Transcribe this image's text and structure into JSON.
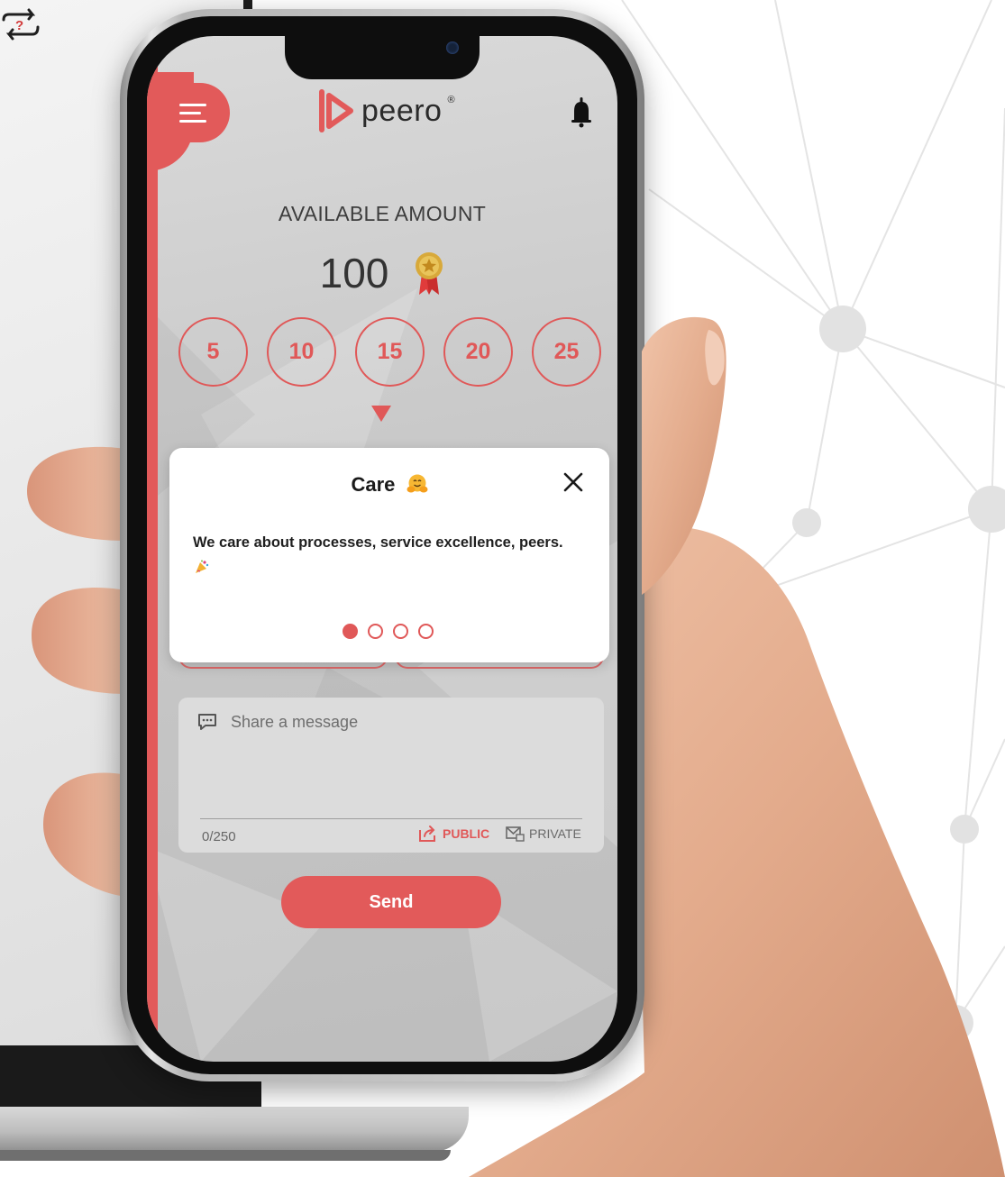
{
  "app": {
    "brand": "peero",
    "brand_mark": "®"
  },
  "header": {
    "menu_icon": "hamburger-menu-icon",
    "notification_icon": "bell-icon"
  },
  "balance": {
    "label": "AVAILABLE AMOUNT",
    "value": "100",
    "icon": "medal-icon"
  },
  "amount_options": [
    "5",
    "10",
    "15",
    "20",
    "25"
  ],
  "value_popup": {
    "title": "Care",
    "title_emoji": "hugging-face-emoji",
    "description": "We care about processes, service excellence, peers.",
    "description_emoji": "party-emoji",
    "page_count": 4,
    "active_page": 1,
    "close_icon": "close-icon"
  },
  "message": {
    "placeholder": "Share a message",
    "value": "",
    "char_count": "0/250",
    "public_label": "PUBLIC",
    "private_label": "PRIVATE",
    "selected_visibility": "public"
  },
  "actions": {
    "send_label": "Send"
  },
  "colors": {
    "accent": "#e25a5a",
    "screen_bg": "#cfcfcf",
    "card_bg": "#ffffff"
  }
}
